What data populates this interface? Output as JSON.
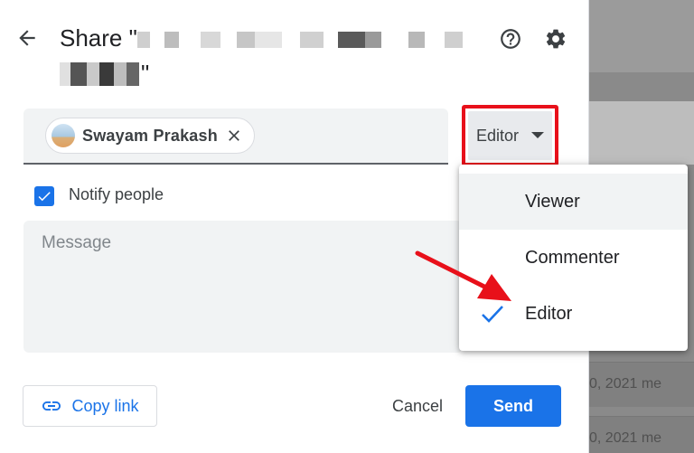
{
  "dialog": {
    "title_prefix": "Share \"",
    "title_suffix": "\"",
    "help_icon": "help-circle-icon",
    "settings_icon": "gear-icon",
    "back_icon": "arrow-back-icon"
  },
  "people": {
    "chip_name": "Swayam Prakash",
    "chip_close_icon": "close-icon",
    "role_label": "Editor",
    "role_icon": "caret-down-icon"
  },
  "notify": {
    "label": "Notify people",
    "checked": true
  },
  "message": {
    "placeholder": "Message"
  },
  "footer": {
    "copy_link_label": "Copy link",
    "copy_link_icon": "link-icon",
    "cancel_label": "Cancel",
    "send_label": "Send"
  },
  "role_menu": {
    "items": [
      {
        "label": "Viewer",
        "selected": false
      },
      {
        "label": "Commenter",
        "selected": false
      },
      {
        "label": "Editor",
        "selected": true
      }
    ],
    "check_icon": "checkmark-icon"
  },
  "background": {
    "rows": [
      {
        "text": "0, 2021  me"
      },
      {
        "text": "0, 2021  me"
      }
    ]
  },
  "colors": {
    "accent": "#1a73e8",
    "highlight_border": "#e8101a",
    "annotation_arrow": "#e8101a"
  }
}
